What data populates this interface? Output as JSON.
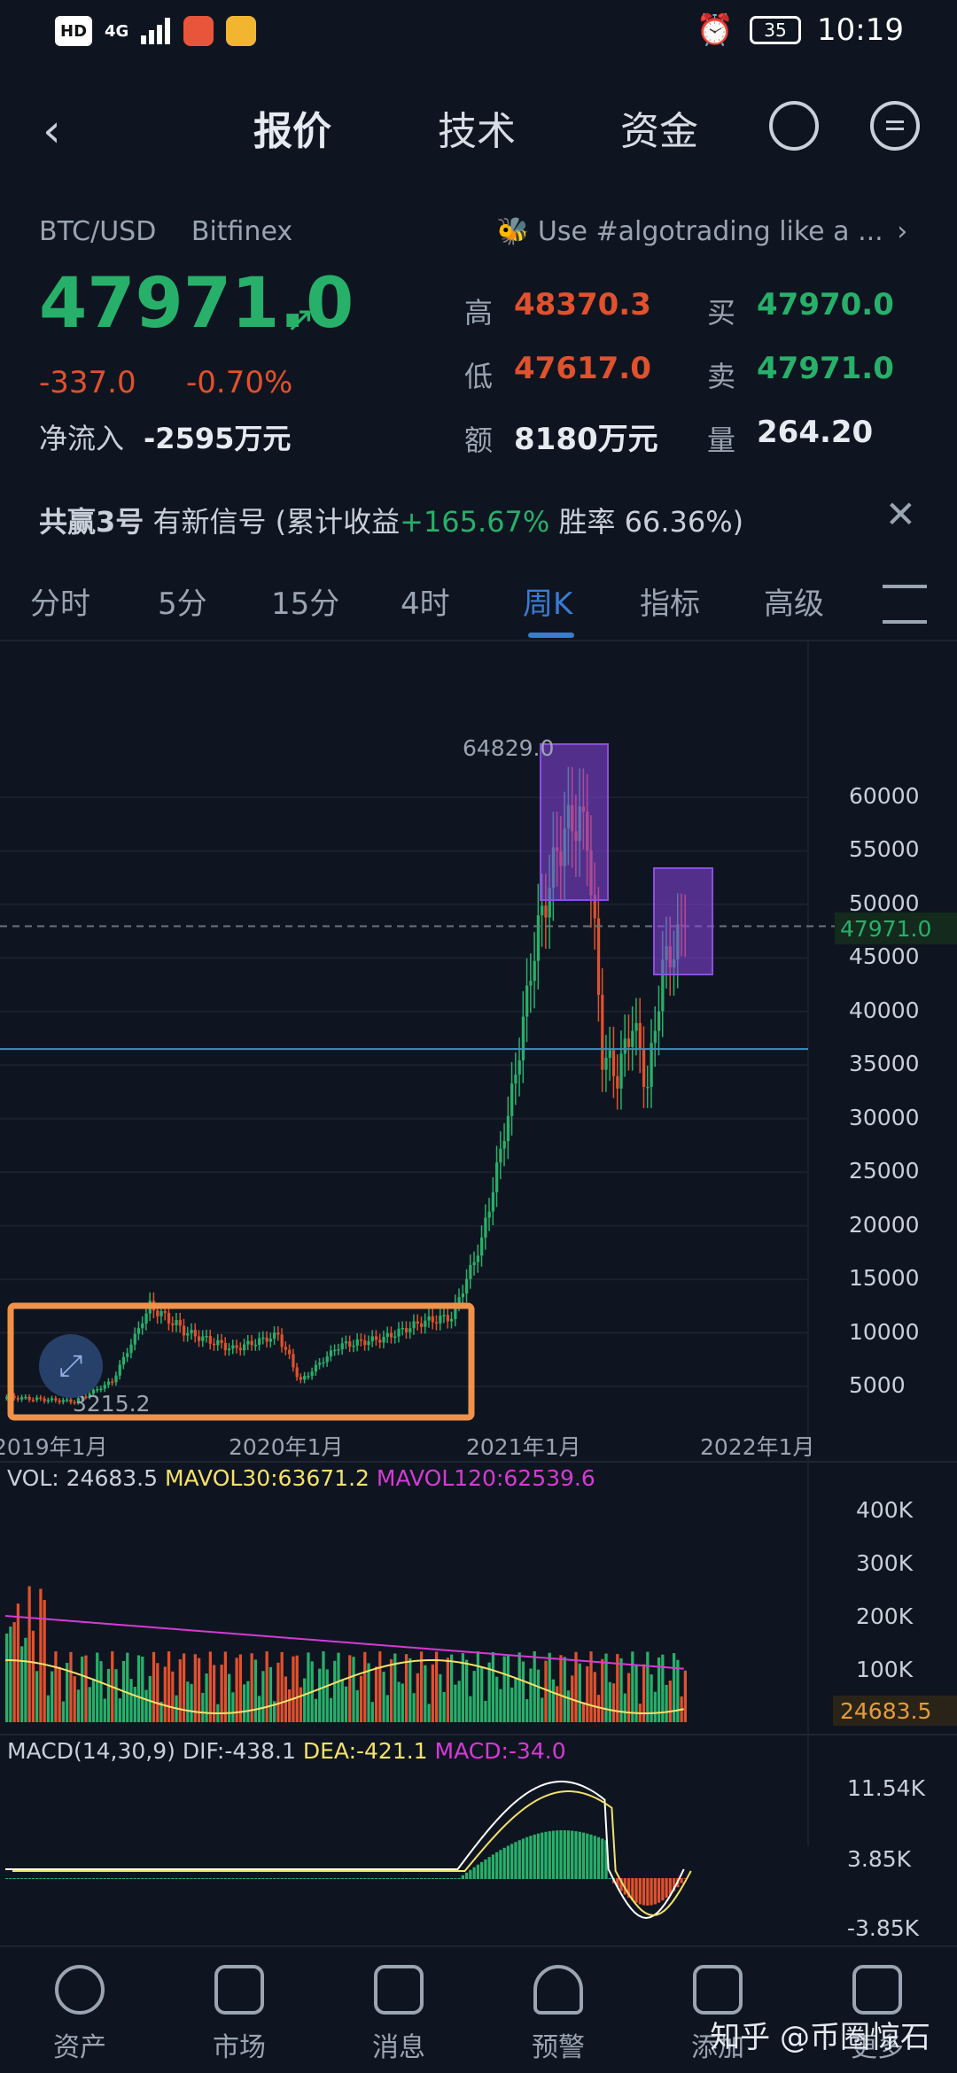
{
  "status_bar": {
    "time": "10:19",
    "battery": "35",
    "hd": "HD",
    "net": "4G"
  },
  "nav": {
    "tabs": [
      "报价",
      "技术",
      "资金"
    ]
  },
  "pair": {
    "symbol": "BTC/USD",
    "exchange": "Bitfinex",
    "promo": "Use #algotrading like a ..."
  },
  "price": {
    "last": "47971.0",
    "change": "-337.0",
    "change_pct": "-0.70%",
    "netflow_label": "净流入",
    "netflow_value": "-2595万元"
  },
  "stats": {
    "high_label": "高",
    "high": "48370.3",
    "low_label": "低",
    "low": "47617.0",
    "amount_label": "额",
    "amount": "8180万元",
    "buy_label": "买",
    "buy": "47970.0",
    "sell_label": "卖",
    "sell": "47971.0",
    "volume_label": "量",
    "volume": "264.20"
  },
  "signal": {
    "name": "共赢3号",
    "text": "有新信号 (累计收益",
    "gain": "+165.67%",
    "winrate": "胜率 66.36%)"
  },
  "periods": [
    "分时",
    "5分",
    "15分",
    "4时",
    "周K",
    "指标",
    "高级"
  ],
  "chart": {
    "y_ticks": [
      "60000",
      "55000",
      "50000",
      "45000",
      "40000",
      "35000",
      "30000",
      "25000",
      "20000",
      "15000",
      "10000",
      "5000"
    ],
    "x_ticks": [
      "2019年1月",
      "2020年1月",
      "2021年1月",
      "2022年1月"
    ],
    "price_tag": "47971.0",
    "high_mark": "64829.0",
    "low_mark": "3215.2"
  },
  "vol": {
    "label": "VOL: 24683.5",
    "mavol30": "MAVOL30:63671.2",
    "mavol120": "MAVOL120:62539.6",
    "ticks": [
      "400K",
      "300K",
      "200K",
      "100K"
    ],
    "tag": "24683.5"
  },
  "macd": {
    "label": "MACD(14,30,9)",
    "dif": "DIF:-438.1",
    "dea": "DEA:-421.1",
    "macd": "MACD:-34.0",
    "ticks": [
      "11.54K",
      "3.85K",
      "-3.85K"
    ]
  },
  "bottom_nav": [
    "资产",
    "市场",
    "消息",
    "预警",
    "添加",
    "更多"
  ],
  "watermark": "知乎 @币圈惊石",
  "colors": {
    "up": "#27b06a",
    "down": "#e0512d",
    "accent": "#3a7bd5",
    "ma30": "#f5e16a",
    "ma120": "#d63ad6"
  }
}
